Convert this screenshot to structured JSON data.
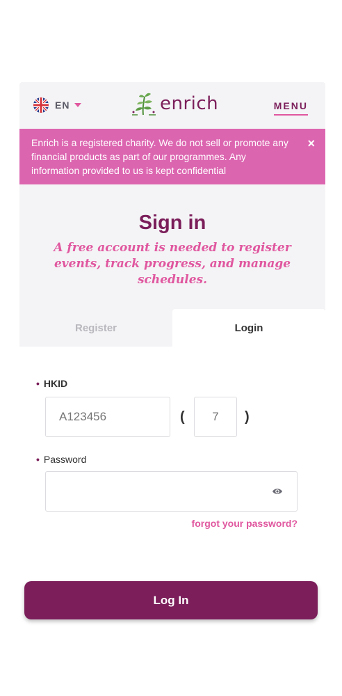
{
  "header": {
    "language": "EN",
    "logo_text": "enrich",
    "menu_label": "MENU"
  },
  "notice": {
    "text": "Enrich is a registered charity. We do not sell or promote any financial products as part of our programmes. Any information provided to us is kept confidential",
    "close_label": "×"
  },
  "signin": {
    "title": "Sign in",
    "subtitle": "A free account is needed to register events, track progress, and manage schedules."
  },
  "tabs": [
    {
      "label": "Register",
      "active": false
    },
    {
      "label": "Login",
      "active": true
    }
  ],
  "form": {
    "hkid_label": "HKID",
    "hkid_placeholder": "A123456",
    "hkid_check_placeholder": "7",
    "paren_open": "(",
    "paren_close": ")",
    "password_label": "Password",
    "password_value": "",
    "forgot_label": "forgot your password?",
    "submit_label": "Log In"
  },
  "colors": {
    "brand": "#7b1e5a",
    "accent_pink": "#e0579f",
    "notice_bg": "#dc65b0"
  },
  "icons": [
    "uk-flag-icon",
    "caret-down-icon",
    "logo-leaf-icon",
    "close-icon",
    "eye-icon"
  ]
}
